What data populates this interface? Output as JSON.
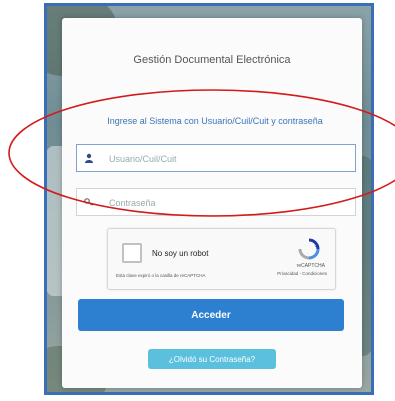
{
  "app": {
    "title": "Gestión Documental Electrónica"
  },
  "login": {
    "instructions": "Ingrese al Sistema con Usuario/Cuil/Cuit y contraseña",
    "username": {
      "placeholder": "Usuario/Cuil/Cuit",
      "icon": "user-icon"
    },
    "password": {
      "placeholder": "Contraseña",
      "icon": "key-icon"
    },
    "submit_label": "Acceder",
    "forgot_label": "¿Olvidó su Contraseña?"
  },
  "captcha": {
    "label": "No soy un robot",
    "brand": "reCAPTCHA",
    "terms": "Privacidad - Condiciones",
    "sub": "Esta clave expiró o la casilla de reCAPTCHA"
  },
  "colors": {
    "accent": "#2d7fd0",
    "link": "#3d74b7",
    "secondary": "#5bc0de",
    "annotation": "#d41a1a",
    "frame": "#3a6fb8"
  }
}
